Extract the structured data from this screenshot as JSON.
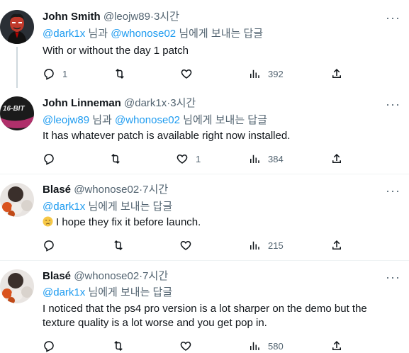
{
  "tweets": [
    {
      "name": "John Smith",
      "handle": "@leojw89",
      "dot": "·",
      "time": "3시간",
      "more": "···",
      "mention_a": "@dark1x",
      "mid_text": " 님과 ",
      "mention_b": "@whonose02",
      "reply_suffix": " 님에게 보내는 답글",
      "text": "With or without the day 1 patch",
      "replies": "1",
      "retweets": "",
      "likes": "",
      "views": "392"
    },
    {
      "name": "John Linneman",
      "handle": "@dark1x",
      "dot": "·",
      "time": "3시간",
      "more": "···",
      "mention_a": "@leojw89",
      "mid_text": " 님과 ",
      "mention_b": "@whonose02",
      "reply_suffix": " 님에게 보내는 답글",
      "text": "It has whatever patch is available right now installed.",
      "avatar_text": "16-BIT",
      "replies": "",
      "retweets": "",
      "likes": "1",
      "views": "384"
    },
    {
      "name": "Blasé",
      "handle": "@whonose02",
      "dot": "·",
      "time": "7시간",
      "more": "···",
      "mention_a": "@dark1x",
      "reply_suffix": " 님에게 보내는 답글",
      "text": "I hope they fix it before launch.",
      "emoji": "crying-face",
      "replies": "",
      "retweets": "",
      "likes": "",
      "views": "215"
    },
    {
      "name": "Blasé",
      "handle": "@whonose02",
      "dot": "·",
      "time": "7시간",
      "more": "···",
      "mention_a": "@dark1x",
      "reply_suffix": " 님에게 보내는 답글",
      "text_line1": "I noticed that the ps4 pro version is a lot sharper on the demo but the",
      "text_line2": "texture quality is a lot worse and you get pop in.",
      "replies": "",
      "retweets": "",
      "likes": "",
      "views": "580"
    }
  ],
  "colors": {
    "link": "#1d9bf0",
    "muted": "#536471",
    "text": "#0f1419"
  }
}
